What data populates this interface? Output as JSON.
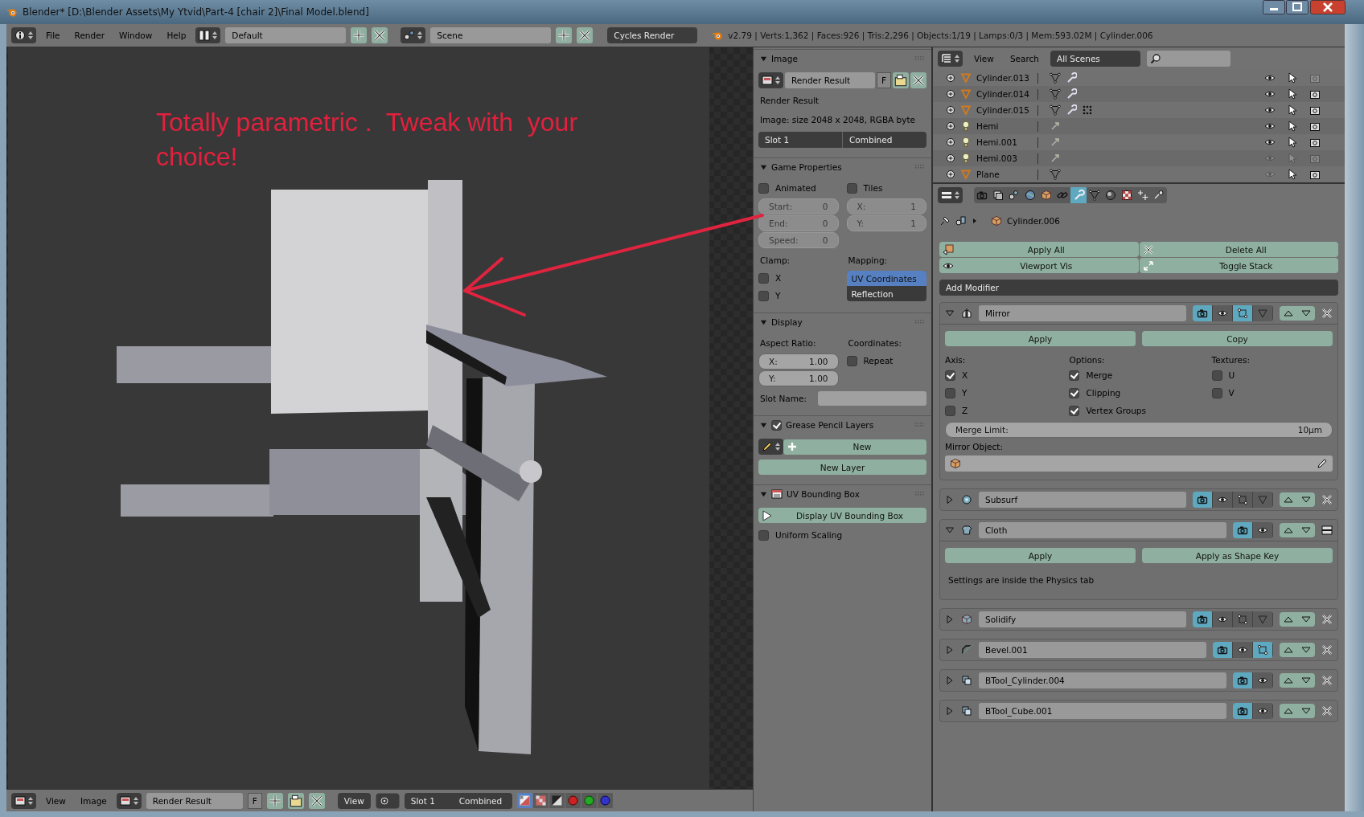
{
  "window": {
    "title": "Blender* [D:\\Blender Assets\\My Ytvid\\Part-4 [chair 2]\\Final Model.blend]"
  },
  "top_header": {
    "menus": [
      "File",
      "Render",
      "Window",
      "Help"
    ],
    "layout": "Default",
    "scene": "Scene",
    "engine": "Cycles Render",
    "stats": "v2.79 | Verts:1,362 | Faces:926 | Tris:2,296 | Objects:1/19 | Lamps:0/3 | Mem:593.02M | Cylinder.006"
  },
  "viewport": {
    "annotation": "Totally parametric .  Tweak with  your choice!"
  },
  "image_panel": {
    "title": "Image",
    "image_name": "Render Result",
    "fake_user": "F",
    "info_name": "Render Result",
    "info": "Image: size 2048 x 2048, RGBA byte",
    "slot": "Slot 1",
    "pass": "Combined"
  },
  "game_properties": {
    "title": "Game Properties",
    "animated": {
      "label": "Animated",
      "checked": false
    },
    "tiles": {
      "label": "Tiles",
      "checked": false
    },
    "anim_fields": [
      {
        "label": "Start:",
        "value": "0"
      },
      {
        "label": "End:",
        "value": "0"
      },
      {
        "label": "Speed:",
        "value": "0"
      }
    ],
    "tile_fields": [
      {
        "label": "X:",
        "value": "1"
      },
      {
        "label": "Y:",
        "value": "1"
      }
    ],
    "clamp_label": "Clamp:",
    "clamp": [
      {
        "label": "X",
        "checked": false
      },
      {
        "label": "Y",
        "checked": false
      }
    ],
    "mapping_label": "Mapping:",
    "mapping": [
      {
        "label": "UV Coordinates",
        "selected": true
      },
      {
        "label": "Reflection",
        "selected": false
      }
    ]
  },
  "display": {
    "title": "Display",
    "aspect_label": "Aspect Ratio:",
    "aspect": [
      {
        "label": "X:",
        "value": "1.00"
      },
      {
        "label": "Y:",
        "value": "1.00"
      }
    ],
    "coordinates_label": "Coordinates:",
    "repeat": {
      "label": "Repeat",
      "checked": false
    },
    "slot_name_label": "Slot Name:"
  },
  "grease_pencil": {
    "title": "Grease Pencil Layers",
    "enabled": true,
    "new_button": "New",
    "new_layer_button": "New Layer"
  },
  "uv_bounding_box": {
    "title": "UV Bounding Box",
    "display_button": "Display UV Bounding Box",
    "uniform_scaling": {
      "label": "Uniform Scaling",
      "checked": false
    }
  },
  "outliner": {
    "menus": [
      "View",
      "Search"
    ],
    "scene_filter": "All Scenes",
    "rows": [
      {
        "name": "Cylinder.013",
        "kind": "mesh",
        "data": [
          {
            "kind": "mesh"
          },
          {
            "kind": "modifier"
          }
        ],
        "visible": true,
        "selectable": true,
        "renderable": false
      },
      {
        "name": "Cylinder.014",
        "kind": "mesh",
        "data": [
          {
            "kind": "mesh"
          },
          {
            "kind": "modifier"
          }
        ],
        "visible": true,
        "selectable": true,
        "renderable": true
      },
      {
        "name": "Cylinder.015",
        "kind": "mesh",
        "data": [
          {
            "kind": "mesh"
          },
          {
            "kind": "modifier"
          },
          {
            "kind": "particles"
          }
        ],
        "visible": true,
        "selectable": true,
        "renderable": true
      },
      {
        "name": "Hemi",
        "kind": "lamp",
        "data": [
          {
            "kind": "lamp"
          }
        ],
        "visible": true,
        "selectable": true,
        "renderable": true
      },
      {
        "name": "Hemi.001",
        "kind": "lamp",
        "data": [
          {
            "kind": "lamp"
          }
        ],
        "visible": true,
        "selectable": true,
        "renderable": true
      },
      {
        "name": "Hemi.003",
        "kind": "lamp",
        "data": [
          {
            "kind": "lamp"
          }
        ],
        "visible": false,
        "selectable": false,
        "renderable": false
      },
      {
        "name": "Plane",
        "kind": "mesh",
        "data": [
          {
            "kind": "mesh"
          }
        ],
        "visible": false,
        "selectable": true,
        "renderable": true
      }
    ]
  },
  "properties": {
    "tabs": [
      {
        "kind": "render",
        "selected": false
      },
      {
        "kind": "layers",
        "selected": false
      },
      {
        "kind": "scene",
        "selected": false
      },
      {
        "kind": "world",
        "selected": false
      },
      {
        "kind": "object",
        "selected": false
      },
      {
        "kind": "constraints",
        "selected": false
      },
      {
        "kind": "modifiers",
        "selected": true
      },
      {
        "kind": "data",
        "selected": false
      },
      {
        "kind": "material",
        "selected": false
      },
      {
        "kind": "texture",
        "selected": false
      },
      {
        "kind": "particles",
        "selected": false
      },
      {
        "kind": "physics",
        "selected": false
      }
    ],
    "object": "Cylinder.006",
    "apply_all": "Apply All",
    "delete_all": "Delete All",
    "viewport_vis": "Viewport Vis",
    "toggle_stack": "Toggle Stack",
    "add_modifier": "Add Modifier",
    "modifiers": [
      {
        "kind": "mirror",
        "name": "Mirror",
        "expanded": true,
        "toggles": [
          {
            "kind": "render",
            "on": true
          },
          {
            "kind": "viewport",
            "on": false
          },
          {
            "kind": "editmode",
            "on": true
          },
          {
            "kind": "cage",
            "on": false
          }
        ],
        "apply": "Apply",
        "copy": "Copy",
        "axis_label": "Axis:",
        "options_label": "Options:",
        "textures_label": "Textures:",
        "axis": [
          {
            "label": "X",
            "checked": true
          },
          {
            "label": "Y",
            "checked": false
          },
          {
            "label": "Z",
            "checked": false
          }
        ],
        "options": [
          {
            "label": "Merge",
            "checked": true
          },
          {
            "label": "Clipping",
            "checked": true
          },
          {
            "label": "Vertex Groups",
            "checked": true
          }
        ],
        "textures": [
          {
            "label": "U",
            "checked": false
          },
          {
            "label": "V",
            "checked": false
          }
        ],
        "merge_limit_label": "Merge Limit:",
        "merge_limit": "10µm",
        "mirror_object_label": "Mirror Object:"
      },
      {
        "kind": "subsurf",
        "name": "Subsurf",
        "expanded": false,
        "toggles": [
          {
            "kind": "render",
            "on": true
          },
          {
            "kind": "viewport",
            "on": false
          },
          {
            "kind": "editmode",
            "on": false
          },
          {
            "kind": "cage",
            "on": false
          }
        ]
      },
      {
        "kind": "cloth",
        "name": "Cloth",
        "expanded": true,
        "toggles": [
          {
            "kind": "render",
            "on": true
          },
          {
            "kind": "viewport",
            "on": false
          }
        ],
        "apply": "Apply",
        "copy": "Apply as Shape Key",
        "note": "Settings are inside the Physics tab"
      },
      {
        "kind": "solidify",
        "name": "Solidify",
        "expanded": false,
        "toggles": [
          {
            "kind": "render",
            "on": true
          },
          {
            "kind": "viewport",
            "on": false
          },
          {
            "kind": "editmode",
            "on": false
          },
          {
            "kind": "cage",
            "on": false
          }
        ]
      },
      {
        "kind": "bevel",
        "name": "Bevel.001",
        "expanded": false,
        "toggles": [
          {
            "kind": "render",
            "on": true
          },
          {
            "kind": "viewport",
            "on": false
          },
          {
            "kind": "editmode",
            "on": true
          }
        ]
      },
      {
        "kind": "boolean",
        "name": "BTool_Cylinder.004",
        "expanded": false,
        "toggles": [
          {
            "kind": "render",
            "on": true
          },
          {
            "kind": "viewport",
            "on": false
          }
        ]
      },
      {
        "kind": "boolean",
        "name": "BTool_Cube.001",
        "expanded": false,
        "toggles": [
          {
            "kind": "render",
            "on": true
          },
          {
            "kind": "viewport",
            "on": false
          }
        ]
      }
    ]
  },
  "bottom_header": {
    "menus": [
      "View",
      "Image"
    ],
    "image": "Render Result",
    "fake_user": "F",
    "view": "View",
    "slot": "Slot 1",
    "pass": "Combined",
    "channels": [
      {
        "kind": "color-alpha",
        "selected": true
      },
      {
        "kind": "color",
        "selected": false
      },
      {
        "kind": "alpha",
        "selected": false
      },
      {
        "kind": "red",
        "selected": false
      },
      {
        "kind": "green",
        "selected": false
      },
      {
        "kind": "blue",
        "selected": false
      }
    ]
  }
}
